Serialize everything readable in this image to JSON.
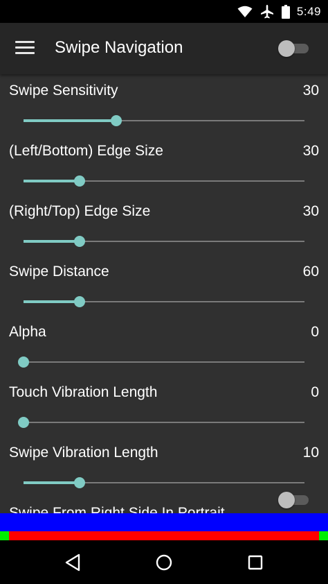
{
  "status_bar": {
    "time": "5:49",
    "icons": [
      "wifi-icon",
      "airplane-icon",
      "battery-icon"
    ]
  },
  "toolbar": {
    "title": "Swipe Navigation",
    "menu_icon": "hamburger-menu-icon",
    "switch_on": false
  },
  "settings": [
    {
      "label": "Swipe Sensitivity",
      "value": "30",
      "level": 0.33
    },
    {
      "label": "(Left/Bottom) Edge Size",
      "value": "30",
      "level": 0.2
    },
    {
      "label": "(Right/Top) Edge Size",
      "value": "30",
      "level": 0.2
    },
    {
      "label": "Swipe Distance",
      "value": "60",
      "level": 0.2
    },
    {
      "label": "Alpha",
      "value": "0",
      "level": 0
    },
    {
      "label": "Touch Vibration Length",
      "value": "0",
      "level": 0
    },
    {
      "label": "Swipe Vibration Length",
      "value": "10",
      "level": 0.2
    }
  ],
  "partial_setting": {
    "label": "Swipe From Right Side In Portrait",
    "switch_on": false
  },
  "colors": {
    "accent": "#80cbc4",
    "background": "#303030",
    "toolbar": "#262626",
    "overlay_blue": "#0000ff",
    "overlay_red": "#ff0000",
    "overlay_green": "#00ee00"
  },
  "nav_bar": {
    "icons": [
      "back-icon",
      "home-icon",
      "recents-icon"
    ]
  }
}
